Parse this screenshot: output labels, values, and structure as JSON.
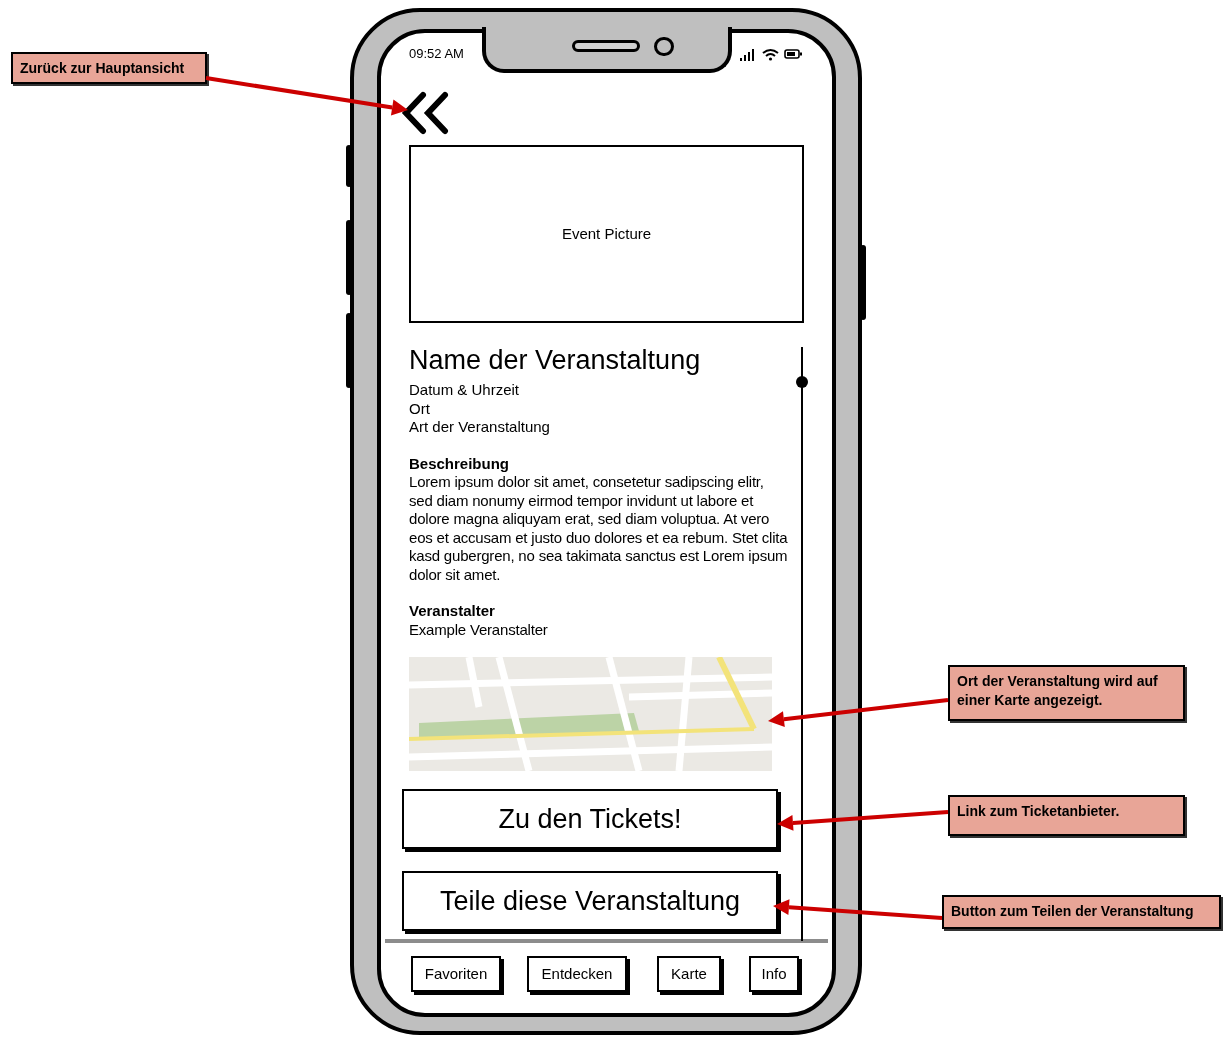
{
  "status_bar": {
    "time": "09:52 AM"
  },
  "event": {
    "picture_label": "Event Picture",
    "title": "Name der Veranstaltung",
    "details": [
      "Datum & Uhrzeit",
      "Ort",
      "Art der Veranstaltung"
    ],
    "sections": [
      {
        "heading": "Beschreibung",
        "text": "Lorem ipsum dolor sit amet, consetetur sadipscing elitr, sed diam nonumy eirmod tempor invidunt ut labore et dolore magna aliquyam erat, sed diam voluptua. At vero eos et accusam et justo duo dolores et ea rebum. Stet clita kasd gubergren, no sea takimata sanctus est Lorem ipsum dolor sit amet."
      },
      {
        "heading": "Veranstalter",
        "text": "Example Veranstalter"
      }
    ],
    "map": {
      "kind": "picture"
    }
  },
  "buttons": [
    "Zu den Tickets!",
    "Teile diese Veranstaltung"
  ],
  "nav": [
    "Favoriten",
    "Entdecken",
    "Karte",
    "Info"
  ],
  "annotations": [
    {
      "text": "Zurück zur Hauptansicht"
    },
    {
      "text": "Ort der Veranstaltung wird auf einer Karte angezeigt."
    },
    {
      "text": "Link zum Ticketanbieter."
    },
    {
      "text": "Button zum Teilen der Veranstaltung"
    }
  ]
}
